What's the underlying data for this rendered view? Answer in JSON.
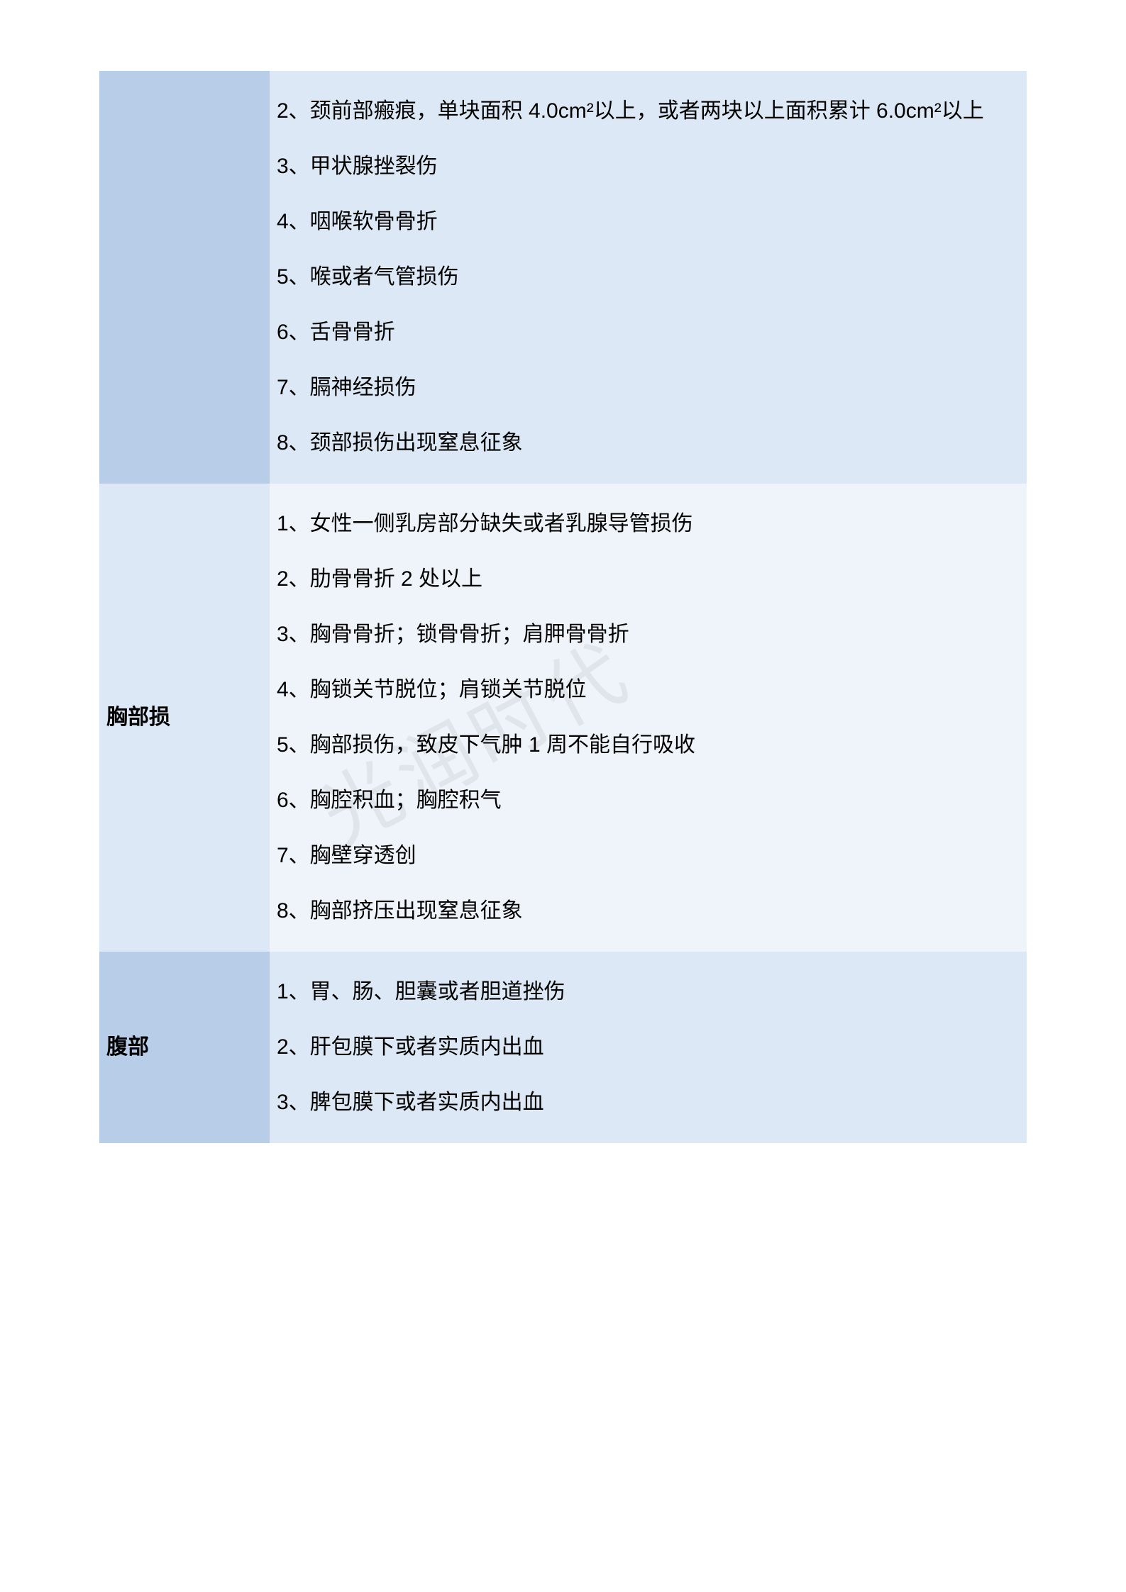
{
  "watermark": "光润时代",
  "rows": [
    {
      "label": "",
      "items": [
        "2、颈前部瘢痕，单块面积 4.0cm²以上，或者两块以上面积累计 6.0cm²以上",
        "3、甲状腺挫裂伤",
        "4、咽喉软骨骨折",
        "5、喉或者气管损伤",
        "6、舌骨骨折",
        "7、膈神经损伤",
        "8、颈部损伤出现窒息征象"
      ]
    },
    {
      "label": "胸部损",
      "items": [
        "1、女性一侧乳房部分缺失或者乳腺导管损伤",
        "2、肋骨骨折 2 处以上",
        "3、胸骨骨折；锁骨骨折；肩胛骨骨折",
        "4、胸锁关节脱位；肩锁关节脱位",
        "5、胸部损伤，致皮下气肿 1 周不能自行吸收",
        "6、胸腔积血；胸腔积气",
        "7、胸壁穿透创",
        "8、胸部挤压出现窒息征象"
      ]
    },
    {
      "label": "腹部",
      "items": [
        "1、胃、肠、胆囊或者胆道挫伤",
        "2、肝包膜下或者实质内出血",
        "3、脾包膜下或者实质内出血"
      ]
    }
  ]
}
